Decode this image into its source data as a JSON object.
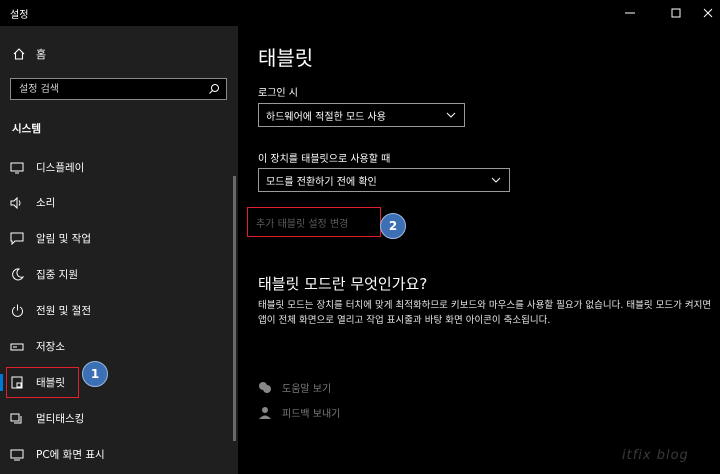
{
  "window": {
    "title": "설정"
  },
  "sidebar": {
    "home_label": "홈",
    "search_placeholder": "설정 검색",
    "section_label": "시스템",
    "items": [
      {
        "label": "디스플레이",
        "icon": "monitor-icon"
      },
      {
        "label": "소리",
        "icon": "speaker-icon"
      },
      {
        "label": "알림 및 작업",
        "icon": "message-icon"
      },
      {
        "label": "집중 지원",
        "icon": "moon-icon"
      },
      {
        "label": "전원 및 절전",
        "icon": "power-icon"
      },
      {
        "label": "저장소",
        "icon": "storage-icon"
      },
      {
        "label": "태블릿",
        "icon": "tablet-icon"
      },
      {
        "label": "멀티태스킹",
        "icon": "multitasking-icon"
      },
      {
        "label": "PC에 화면 표시",
        "icon": "project-icon"
      }
    ]
  },
  "main": {
    "title": "태블릿",
    "signin_label": "로그인 시",
    "signin_value": "하드웨어에 적절한 모드 사용",
    "tablet_label": "이 장치를 태블릿으로 사용할 때",
    "tablet_value": "모드를 전환하기 전에 확인",
    "extra_link": "추가 태블릿 설정 변경",
    "question": "태블릿 모드란 무엇인가요?",
    "description": "태블릿 모드는 장치를 터치에 맞게 최적화하므로 키보드와 마우스를 사용할 필요가 없습니다. 태블릿 모드가 켜지면 앱이 전체 화면으로 열리고 작업 표시줄과 바탕 화면 아이콘이 축소됩니다.",
    "help_link": "도움말 보기",
    "feedback_link": "피드백 보내기"
  },
  "annotations": {
    "badge1": "1",
    "badge2": "2"
  },
  "watermark": "itfix blog",
  "colors": {
    "accent": "#0078d7",
    "highlight": "#e0202a",
    "badge": "#3c6fb4"
  }
}
